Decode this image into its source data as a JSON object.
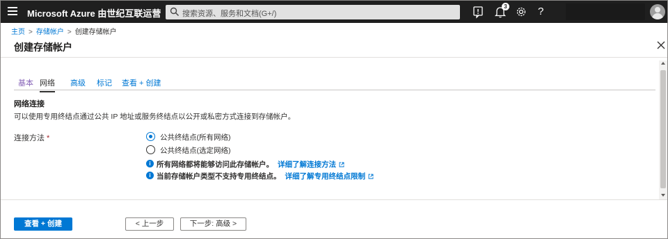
{
  "topbar": {
    "brand": "Microsoft Azure 由世纪互联运营",
    "search_placeholder": "搜索资源、服务和文档(G+/)",
    "notification_count": "3",
    "help_label": "?"
  },
  "breadcrumb": {
    "items": [
      "主页",
      "存储帐户",
      "创建存储帐户"
    ],
    "separator": ">"
  },
  "blade": {
    "title": "创建存储帐户",
    "close_label": "✕"
  },
  "tabs": [
    {
      "label": "基本",
      "state": "visited"
    },
    {
      "label": "网络",
      "state": "active"
    },
    {
      "label": "高级",
      "state": "normal"
    },
    {
      "label": "标记",
      "state": "normal"
    },
    {
      "label": "查看 + 创建",
      "state": "normal"
    }
  ],
  "section": {
    "title": "网络连接",
    "description": "可以使用专用终结点通过公共 IP 地址或服务终结点以公开或私密方式连接到存储帐户。"
  },
  "connectivity": {
    "label": "连接方法",
    "required_mark": "*",
    "options": [
      {
        "label": "公共终结点(所有网络)",
        "checked": true
      },
      {
        "label": "公共终结点(选定网络)",
        "checked": false
      }
    ],
    "info": [
      {
        "text": "所有网络都将能够访问此存储帐户。",
        "link": "详细了解连接方法"
      },
      {
        "text": "当前存储帐户类型不支持专用终结点。",
        "link": "详细了解专用终结点限制"
      }
    ]
  },
  "footer": {
    "review_create": "查看 + 创建",
    "previous": "< 上一步",
    "next": "下一步: 高级 >"
  },
  "colors": {
    "accent": "#0078d4",
    "topbar": "#1f1f1f",
    "visited_tab": "#8764b8",
    "required": "#a4262c"
  }
}
